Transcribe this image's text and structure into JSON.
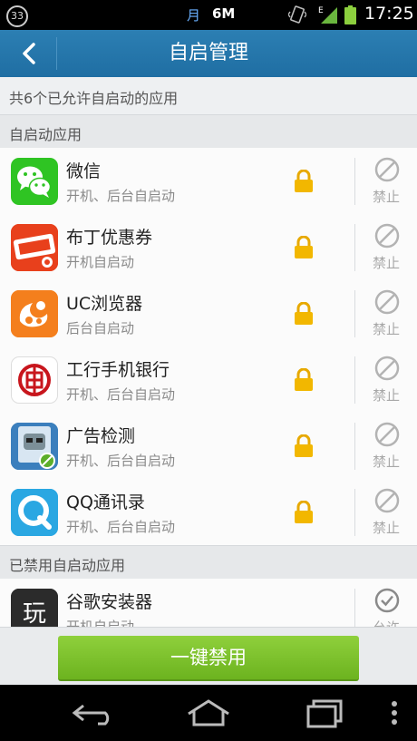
{
  "status_bar": {
    "badge": "33",
    "carrier": "月",
    "data": "6M",
    "network": "E",
    "time": "17:25"
  },
  "header": {
    "title": "自启管理"
  },
  "summary": "共6个已允许自启动的应用",
  "sections": {
    "enabled_title": "自启动应用",
    "disabled_title": "已禁用自启动应用"
  },
  "enabled_apps": [
    {
      "name": "微信",
      "desc": "开机、后台自启动",
      "action": "禁止",
      "icon": "wechat-icon"
    },
    {
      "name": "布丁优惠券",
      "desc": "开机自启动",
      "action": "禁止",
      "icon": "coupon-icon"
    },
    {
      "name": "UC浏览器",
      "desc": "后台自启动",
      "action": "禁止",
      "icon": "uc-browser-icon"
    },
    {
      "name": "工行手机银行",
      "desc": "开机、后台自启动",
      "action": "禁止",
      "icon": "icbc-icon"
    },
    {
      "name": "广告检测",
      "desc": "开机、后台自启动",
      "action": "禁止",
      "icon": "ad-detector-icon"
    },
    {
      "name": "QQ通讯录",
      "desc": "开机、后台自启动",
      "action": "禁止",
      "icon": "qq-contacts-icon"
    }
  ],
  "disabled_apps": [
    {
      "name": "谷歌安装器",
      "desc": "开机自启动",
      "action": "允许",
      "icon": "google-installer-icon"
    }
  ],
  "bulk_disable_label": "一键禁用",
  "colors": {
    "title_bar": "#1f6ea3",
    "button_green": "#7cc22b",
    "lock": "#f0b400"
  }
}
